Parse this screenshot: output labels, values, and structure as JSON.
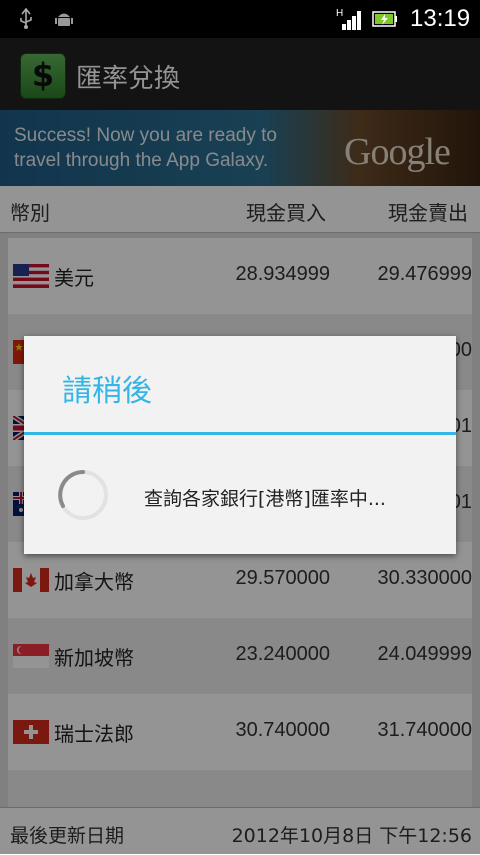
{
  "status_bar": {
    "network_type": "H",
    "time": "13:19",
    "icons": [
      "usb-icon",
      "android-debug-icon",
      "signal-icon",
      "battery-icon"
    ]
  },
  "app": {
    "icon_symbol": "$",
    "title": "匯率兌換"
  },
  "ad_banner": {
    "line1": "Success! Now you are ready to",
    "line2": "travel through the App Galaxy.",
    "logo": "Google"
  },
  "list_header": {
    "currency": "幣別",
    "cash_buy": "現金買入",
    "cash_sell": "現金賣出"
  },
  "rows": [
    {
      "flag": "us-flag-icon",
      "name": "美元",
      "buy": "28.934999",
      "sell": "29.476999"
    },
    {
      "flag": "cn-flag-icon",
      "name": "",
      "buy": "",
      "sell": "00"
    },
    {
      "flag": "gb-flag-icon",
      "name": "",
      "buy": "",
      "sell": "01"
    },
    {
      "flag": "au-flag-icon",
      "name": "",
      "buy": "",
      "sell": "01"
    },
    {
      "flag": "ca-flag-icon",
      "name": "加拿大幣",
      "buy": "29.570000",
      "sell": "30.330000"
    },
    {
      "flag": "sg-flag-icon",
      "name": "新加坡幣",
      "buy": "23.240000",
      "sell": "24.049999"
    },
    {
      "flag": "ch-flag-icon",
      "name": "瑞士法郎",
      "buy": "30.740000",
      "sell": "31.740000"
    }
  ],
  "footer": {
    "label": "最後更新日期",
    "date": "2012年10月8日 下午12:56"
  },
  "dialog": {
    "title": "請稍後",
    "message": "查詢各家銀行[港幣]匯率中..."
  },
  "colors": {
    "accent": "#33b5e5",
    "dialog_bg": "#f2f2f2",
    "action_bar": "#222222"
  }
}
